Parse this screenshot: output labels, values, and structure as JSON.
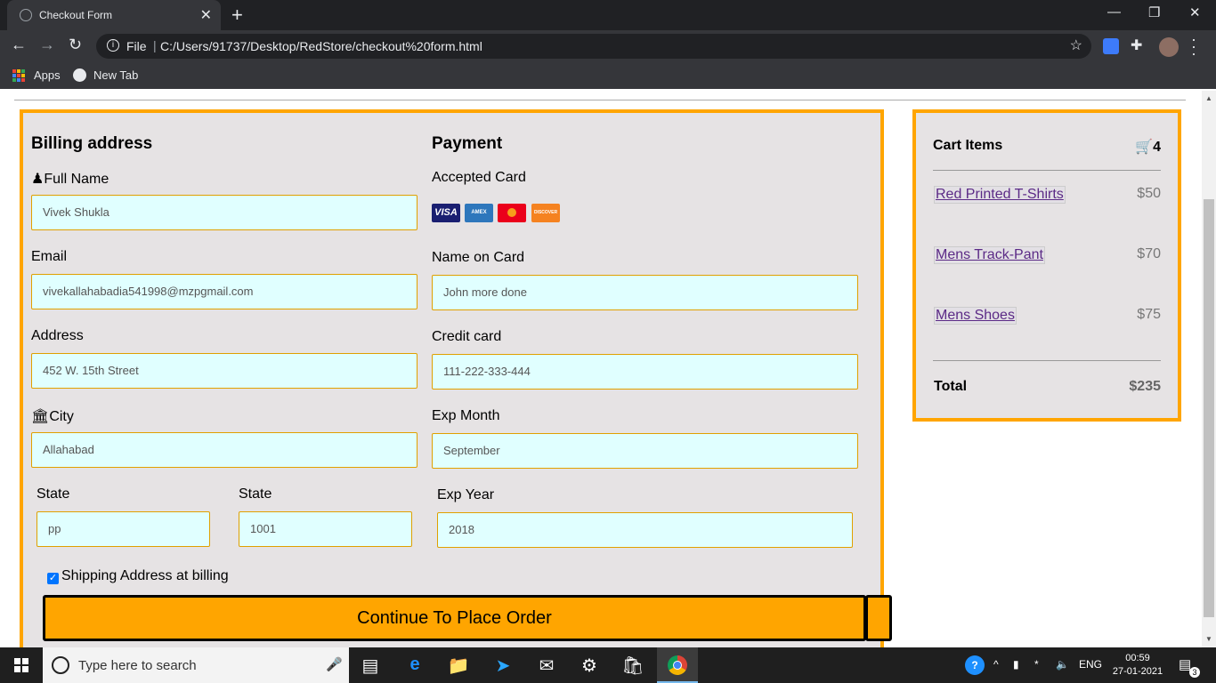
{
  "browser": {
    "tab_title": "Checkout Form",
    "tab_close": "✕",
    "new_tab": "+",
    "minimize": "—",
    "restore": "❐",
    "close": "✕",
    "scheme_label": "File",
    "url": "C:/Users/91737/Desktop/RedStore/checkout%20form.html",
    "bookmarks": [
      {
        "label": "Apps"
      },
      {
        "label": "New Tab"
      }
    ]
  },
  "billing": {
    "heading": "Billing address",
    "full_name_label": "Full Name",
    "full_name_value": "Vivek Shukla",
    "email_label": "Email",
    "email_value": "vivekallahabadia541998@mzpgmail.com",
    "address_label": "Address",
    "address_value": "452 W. 15th Street",
    "city_label": "City",
    "city_value": "Allahabad",
    "state_label": "State",
    "state_value": "pp",
    "state2_label": "State",
    "state2_value": "1001"
  },
  "payment": {
    "heading": "Payment",
    "accepted_label": "Accepted Card",
    "cards": [
      "VISA",
      "AMEX",
      "MC",
      "DISCOVER"
    ],
    "name_on_card_label": "Name on Card",
    "name_on_card_value": "John more done",
    "credit_card_label": "Credit card",
    "credit_card_value": "111-222-333-444",
    "exp_month_label": "Exp Month",
    "exp_month_value": "September",
    "exp_year_label": "Exp Year",
    "exp_year_value": "2018"
  },
  "shipping_checkbox_label": "Shipping Address at billing",
  "shipping_checked": true,
  "submit_label": "Continue To Place Order",
  "cart": {
    "title": "Cart Items",
    "count": "4",
    "items": [
      {
        "name": "Red Printed T-Shirts",
        "price": "$50"
      },
      {
        "name": "Mens Track-Pant",
        "price": "$70"
      },
      {
        "name": "Mens Shoes",
        "price": "$75"
      }
    ],
    "total_label": "Total",
    "total_value": "$235"
  },
  "taskbar": {
    "search_placeholder": "Type here to search",
    "language": "ENG",
    "time": "00:59",
    "date": "27-01-2021",
    "notifications": "3"
  },
  "colors": {
    "accent": "#ffa500",
    "input_bg": "#e0ffff",
    "panel_bg": "#e6e3e4"
  }
}
